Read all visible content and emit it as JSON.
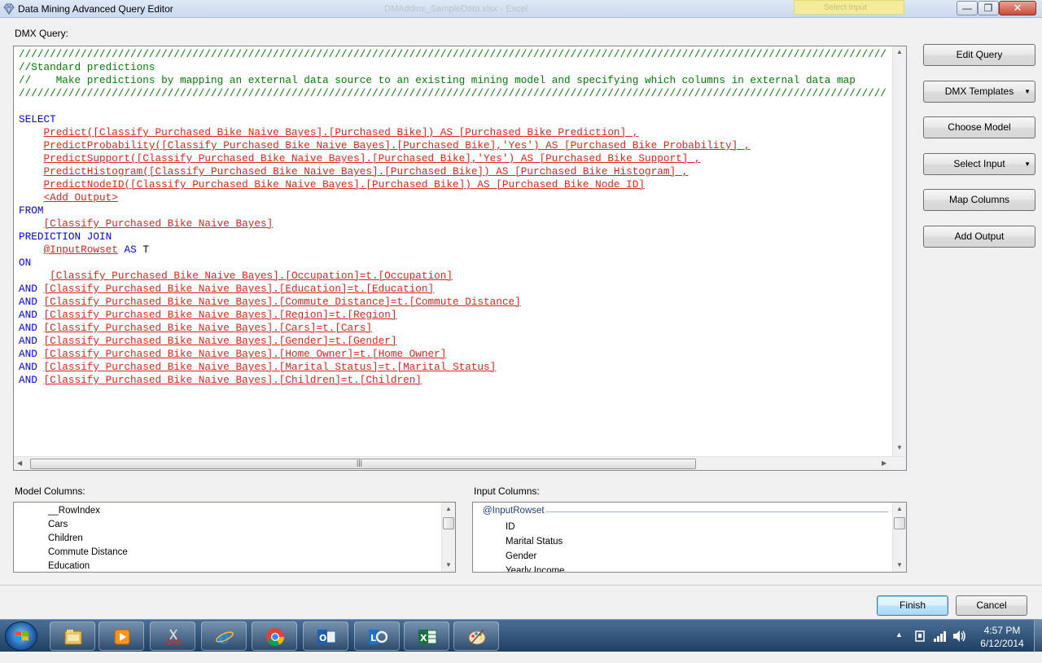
{
  "window": {
    "title": "Data Mining Advanced Query Editor",
    "background_title": "DMAddins_SampleData.xlsx - Excel",
    "yellow_button": "Select Input"
  },
  "labels": {
    "dmx_query": "DMX Query:",
    "model_columns": "Model Columns:",
    "input_columns": "Input Columns:"
  },
  "query_lines": [
    [
      {
        "t": "////////////////////////////////////////////////////////////////////////////////////////////////////////////////////////////////////////////",
        "c": "comment"
      }
    ],
    [
      {
        "t": "//Standard predictions",
        "c": "comment"
      }
    ],
    [
      {
        "t": "//    Make predictions by mapping an external data source to an existing mining model and specifying which columns in external data map",
        "c": "comment"
      }
    ],
    [
      {
        "t": "////////////////////////////////////////////////////////////////////////////////////////////////////////////////////////////////////////////",
        "c": "comment"
      }
    ],
    [
      {
        "t": "",
        "c": "plain"
      }
    ],
    [
      {
        "t": "SELECT",
        "c": "kw"
      }
    ],
    [
      {
        "t": "    ",
        "c": "plain"
      },
      {
        "t": "Predict([Classify Purchased Bike Naive Bayes].[Purchased Bike]) AS [Purchased Bike Prediction] ,",
        "c": "ref"
      }
    ],
    [
      {
        "t": "    ",
        "c": "plain"
      },
      {
        "t": "PredictProbability([Classify Purchased Bike Naive Bayes].[Purchased Bike],'Yes') AS [Purchased Bike Probability] ,",
        "c": "ref"
      }
    ],
    [
      {
        "t": "    ",
        "c": "plain"
      },
      {
        "t": "PredictSupport([Classify Purchased Bike Naive Bayes].[Purchased Bike],'Yes') AS [Purchased Bike Support] ,",
        "c": "ref"
      }
    ],
    [
      {
        "t": "    ",
        "c": "plain"
      },
      {
        "t": "PredictHistogram([Classify Purchased Bike Naive Bayes].[Purchased Bike]) AS [Purchased Bike Histogram] ,",
        "c": "ref"
      }
    ],
    [
      {
        "t": "    ",
        "c": "plain"
      },
      {
        "t": "PredictNodeID([Classify Purchased Bike Naive Bayes].[Purchased Bike]) AS [Purchased Bike Node ID]",
        "c": "ref"
      }
    ],
    [
      {
        "t": "    ",
        "c": "plain"
      },
      {
        "t": "<Add Output>",
        "c": "ref"
      }
    ],
    [
      {
        "t": "FROM",
        "c": "kw"
      }
    ],
    [
      {
        "t": "    ",
        "c": "plain"
      },
      {
        "t": "[Classify Purchased Bike Naive Bayes]",
        "c": "ref"
      }
    ],
    [
      {
        "t": "PREDICTION JOIN",
        "c": "kw"
      }
    ],
    [
      {
        "t": "    ",
        "c": "plain"
      },
      {
        "t": "@InputRowset",
        "c": "ref"
      },
      {
        "t": " AS ",
        "c": "kw"
      },
      {
        "t": "T",
        "c": "plain"
      }
    ],
    [
      {
        "t": "ON",
        "c": "kw"
      }
    ],
    [
      {
        "t": "     ",
        "c": "plain"
      },
      {
        "t": "[Classify Purchased Bike Naive Bayes].[Occupation]=t.[Occupation]",
        "c": "ref"
      }
    ],
    [
      {
        "t": "AND ",
        "c": "kw"
      },
      {
        "t": "[Classify Purchased Bike Naive Bayes].[Education]=t.[Education]",
        "c": "ref"
      }
    ],
    [
      {
        "t": "AND ",
        "c": "kw"
      },
      {
        "t": "[Classify Purchased Bike Naive Bayes].[Commute Distance]=t.[Commute Distance]",
        "c": "ref"
      }
    ],
    [
      {
        "t": "AND ",
        "c": "kw"
      },
      {
        "t": "[Classify Purchased Bike Naive Bayes].[Region]=t.[Region]",
        "c": "ref"
      }
    ],
    [
      {
        "t": "AND ",
        "c": "kw"
      },
      {
        "t": "[Classify Purchased Bike Naive Bayes].[Cars]=t.[Cars]",
        "c": "ref"
      }
    ],
    [
      {
        "t": "AND ",
        "c": "kw"
      },
      {
        "t": "[Classify Purchased Bike Naive Bayes].[Gender]=t.[Gender]",
        "c": "ref"
      }
    ],
    [
      {
        "t": "AND ",
        "c": "kw"
      },
      {
        "t": "[Classify Purchased Bike Naive Bayes].[Home Owner]=t.[Home Owner]",
        "c": "ref"
      }
    ],
    [
      {
        "t": "AND ",
        "c": "kw"
      },
      {
        "t": "[Classify Purchased Bike Naive Bayes].[Marital Status]=t.[Marital Status]",
        "c": "ref"
      }
    ],
    [
      {
        "t": "AND ",
        "c": "kw"
      },
      {
        "t": "[Classify Purchased Bike Naive Bayes].[Children]=t.[Children]",
        "c": "ref"
      }
    ]
  ],
  "buttons": {
    "edit_query": "Edit Query",
    "dmx_templates": "DMX Templates",
    "choose_model": "Choose Model",
    "select_input": "Select Input",
    "map_columns": "Map Columns",
    "add_output": "Add Output",
    "finish": "Finish",
    "cancel": "Cancel"
  },
  "model_columns": [
    "__RowIndex",
    "Cars",
    "Children",
    "Commute Distance",
    "Education"
  ],
  "input_columns": {
    "group": "@InputRowset",
    "items": [
      "ID",
      "Marital Status",
      "Gender",
      "Yearly Income"
    ]
  },
  "taskbar": {
    "apps": [
      "windows-explorer",
      "media-player",
      "snipping-tool",
      "internet-explorer",
      "chrome",
      "outlook",
      "lync",
      "excel",
      "paint"
    ],
    "time": "4:57 PM",
    "date": "6/12/2014"
  },
  "colors": {
    "comment": "#008000",
    "keyword": "#0000ff",
    "reference": "#e0261b",
    "taskbar": "#2b5078"
  }
}
